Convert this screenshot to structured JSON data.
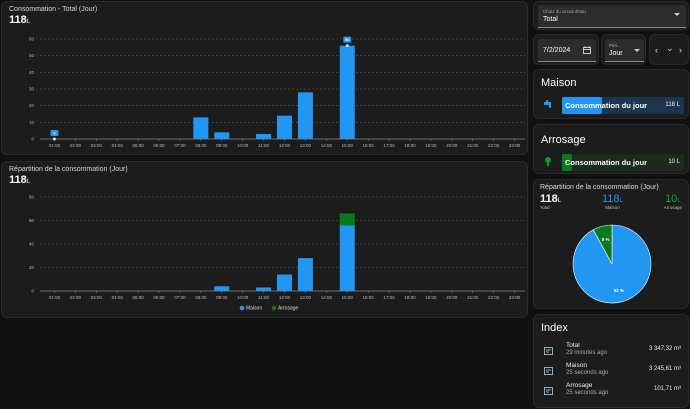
{
  "card1": {
    "title": "Consommation - Total (Jour)",
    "value": "118",
    "unit": "L"
  },
  "card2": {
    "title": "Répartition de la consommation (Jour)",
    "value": "118",
    "unit": "L"
  },
  "hours": [
    "01:00",
    "02:00",
    "03:00",
    "04:00",
    "05:00",
    "06:00",
    "07:00",
    "08:00",
    "09:00",
    "10:00",
    "11:00",
    "12:00",
    "13:00",
    "14:00",
    "15:00",
    "16:00",
    "17:00",
    "18:00",
    "19:00",
    "20:00",
    "21:00",
    "22:00",
    "23:00"
  ],
  "chart_data": [
    {
      "type": "bar",
      "title": "Consommation - Total (Jour)",
      "categories": [
        "01:00",
        "02:00",
        "03:00",
        "04:00",
        "05:00",
        "06:00",
        "07:00",
        "08:00",
        "09:00",
        "10:00",
        "11:00",
        "12:00",
        "13:00",
        "14:00",
        "15:00",
        "16:00",
        "17:00",
        "18:00",
        "19:00",
        "20:00",
        "21:00",
        "22:00",
        "23:00"
      ],
      "series": [
        {
          "values": [
            0,
            0,
            0,
            0,
            0,
            0,
            0,
            13,
            4,
            0,
            3,
            14,
            28,
            0,
            56,
            0,
            0,
            0,
            0,
            0,
            0,
            0,
            0
          ]
        }
      ],
      "ylim": [
        0,
        60
      ],
      "yticks": [
        0,
        10,
        20,
        30,
        40,
        50,
        60
      ],
      "grid": true,
      "point_labels": {
        "01:00": "0",
        "15:00": "56"
      }
    },
    {
      "type": "bar",
      "stacked": true,
      "title": "Répartition de la consommation (Jour)",
      "categories": [
        "01:00",
        "02:00",
        "03:00",
        "04:00",
        "05:00",
        "06:00",
        "07:00",
        "08:00",
        "09:00",
        "10:00",
        "11:00",
        "12:00",
        "13:00",
        "14:00",
        "15:00",
        "16:00",
        "17:00",
        "18:00",
        "19:00",
        "20:00",
        "21:00",
        "22:00",
        "23:00"
      ],
      "series": [
        {
          "name": "Maison",
          "values": [
            0,
            0,
            0,
            0,
            0,
            0,
            0,
            0,
            4,
            0,
            3,
            14,
            28,
            0,
            56,
            0,
            0,
            0,
            0,
            0,
            0,
            0,
            0
          ]
        },
        {
          "name": "Arrosage",
          "values": [
            0,
            0,
            0,
            0,
            0,
            0,
            0,
            0,
            0,
            0,
            0,
            0,
            0,
            0,
            10,
            0,
            0,
            0,
            0,
            0,
            0,
            0,
            0
          ]
        }
      ],
      "ylim": [
        0,
        80
      ],
      "yticks": [
        0,
        20,
        40,
        60,
        80
      ],
      "grid": true,
      "legend": "bottom"
    },
    {
      "type": "pie",
      "title": "Répartition de la consommation (Jour)",
      "categories": [
        "Maison",
        "Arrosage"
      ],
      "values": [
        92,
        8
      ],
      "labels": [
        "92 %",
        "8 %"
      ]
    }
  ],
  "colors": {
    "maison": "#2196f3",
    "arrosage": "#0b7a1f"
  },
  "circuit": {
    "label": "Choix du circuit d'eau",
    "value": "Total"
  },
  "date": {
    "value": "7/2/2024"
  },
  "period": {
    "label": "Péri...",
    "value": "Jour"
  },
  "maison": {
    "title": "Maison",
    "bar_label": "Consommation du jour",
    "value": "118 L",
    "fill": 0.33
  },
  "arrosage": {
    "title": "Arrosage",
    "bar_label": "Consommation du jour",
    "value": "10 L",
    "fill": 0.08
  },
  "repartition": {
    "title": "Répartition de la consommation (Jour)",
    "total": {
      "value": "118",
      "unit": "L",
      "label": "Total"
    },
    "maison": {
      "value": "118",
      "unit": "L",
      "label": "Maison"
    },
    "arrosage": {
      "value": "10",
      "unit": "L",
      "label": "Arrosage"
    }
  },
  "index": {
    "title": "Index",
    "rows": [
      {
        "name": "Total",
        "time": "29 minutes ago",
        "value": "3 347,32 m³"
      },
      {
        "name": "Maison",
        "time": "25 seconds ago",
        "value": "3 245,61 m³"
      },
      {
        "name": "Arrosage",
        "time": "25 seconds ago",
        "value": "101,71 m³"
      }
    ]
  }
}
